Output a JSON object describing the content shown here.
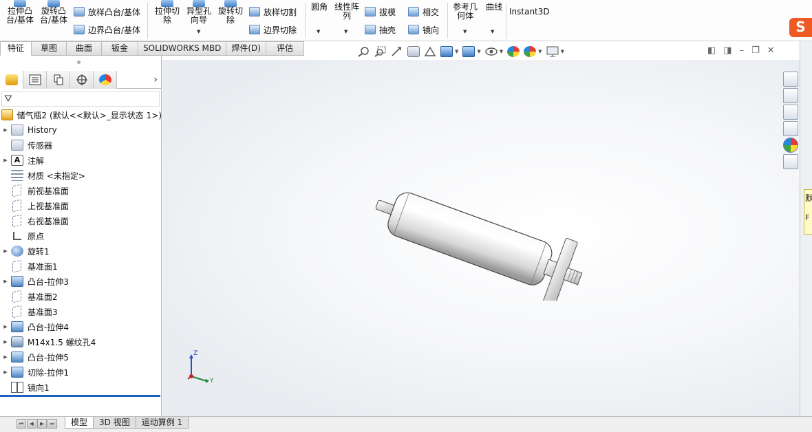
{
  "ribbon": {
    "extrude_boss": [
      "拉伸凸",
      "台/基体"
    ],
    "revolve_boss": [
      "旋转凸",
      "台/基体"
    ],
    "loft_boss": "放样凸台/基体",
    "boundary_boss": "边界凸台/基体",
    "extrude_cut": [
      "拉伸切",
      "除"
    ],
    "hole_wizard": [
      "异型孔",
      "向导"
    ],
    "revolve_cut": [
      "旋转切",
      "除"
    ],
    "loft_cut": "放样切割",
    "boundary_cut": "边界切除",
    "fillet": "圆角",
    "linear_pattern": [
      "线性阵",
      "列"
    ],
    "draft": "拔模",
    "shell": "抽壳",
    "intersect": "相交",
    "mirror": "镜向",
    "ref_geometry": [
      "参考几",
      "何体"
    ],
    "curves": "曲线",
    "instant3d": "Instant3D"
  },
  "command_tabs": [
    "特征",
    "草图",
    "曲面",
    "钣金",
    "SOLIDWORKS MBD",
    "焊件(D)",
    "评估"
  ],
  "brand_logo": "S",
  "feature_tree": {
    "root": "储气瓶2  (默认<<默认>_显示状态 1>)",
    "items": [
      {
        "label": "History",
        "icon": "history-folder-icon",
        "expandable": true
      },
      {
        "label": "传感器",
        "icon": "sensors-folder-icon",
        "expandable": false
      },
      {
        "label": "注解",
        "icon": "annotations-icon",
        "expandable": true
      },
      {
        "label": "材质 <未指定>",
        "icon": "material-icon",
        "expandable": false
      },
      {
        "label": "前视基准面",
        "icon": "plane-icon",
        "expandable": false
      },
      {
        "label": "上视基准面",
        "icon": "plane-icon",
        "expandable": false
      },
      {
        "label": "右视基准面",
        "icon": "plane-icon",
        "expandable": false
      },
      {
        "label": "原点",
        "icon": "origin-icon",
        "expandable": false
      },
      {
        "label": "旋转1",
        "icon": "revolve-feature-icon",
        "expandable": true
      },
      {
        "label": "基准面1",
        "icon": "plane-icon",
        "expandable": false
      },
      {
        "label": "凸台-拉伸3",
        "icon": "boss-extrude-icon",
        "expandable": true
      },
      {
        "label": "基准面2",
        "icon": "plane-icon",
        "expandable": false
      },
      {
        "label": "基准面3",
        "icon": "plane-icon",
        "expandable": false
      },
      {
        "label": "凸台-拉伸4",
        "icon": "boss-extrude-icon",
        "expandable": true
      },
      {
        "label": "M14x1.5 螺纹孔4",
        "icon": "hole-wizard-icon",
        "expandable": true
      },
      {
        "label": "凸台-拉伸5",
        "icon": "boss-extrude-icon",
        "expandable": true
      },
      {
        "label": "切除-拉伸1",
        "icon": "cut-extrude-icon",
        "expandable": true
      },
      {
        "label": "镜向1",
        "icon": "mirror-feature-icon",
        "expandable": false
      }
    ]
  },
  "bottom_tabs": [
    "模型",
    "3D 视图",
    "运动算例 1"
  ],
  "triad": {
    "z": "Z",
    "y": "Y"
  },
  "task_pane_note": [
    "默",
    "F"
  ],
  "colors": {
    "accent": "#1e5fbf",
    "brand": "#ef5a24"
  }
}
